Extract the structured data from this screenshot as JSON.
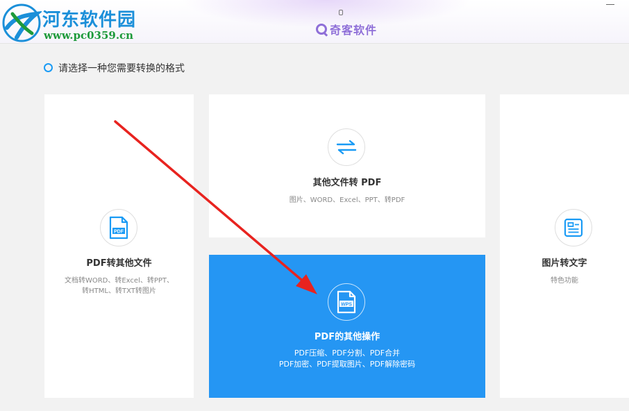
{
  "watermark": {
    "name": "河东软件园",
    "url": "www.pc0359.cn"
  },
  "app": {
    "brand": "奇客软件"
  },
  "prompt": {
    "text": "请选择一种您需要转换的格式"
  },
  "cards": {
    "pdf_to_other": {
      "icon": "pdf-file-icon",
      "icon_text": "PDF",
      "title": "PDF转其他文件",
      "desc_line1": "文档转WORD、转Excel、转PPT、",
      "desc_line2": "转HTML、转TXT转图片"
    },
    "other_to_pdf": {
      "icon": "swap-arrows-icon",
      "title": "其他文件转 PDF",
      "desc": "图片、WORD、Excel、PPT、转PDF"
    },
    "pdf_ops": {
      "icon": "wps-file-icon",
      "icon_text": "WPS",
      "title": "PDF的其他操作",
      "desc_line1": "PDF压缩、PDF分割、PDF合并",
      "desc_line2": "PDF加密、PDF提取图片、PDF解除密码",
      "selected": true
    },
    "img_to_text": {
      "icon": "ocr-card-icon",
      "title": "图片转文字",
      "desc": "特色功能"
    }
  },
  "annotation": {
    "icon": "red-arrow-icon"
  },
  "colors": {
    "accent": "#2596f3",
    "brand": "#8f6fd8",
    "annotation": "#e8231f",
    "watermark_name": "#1b8fd9",
    "watermark_url": "#1e9a3a"
  }
}
